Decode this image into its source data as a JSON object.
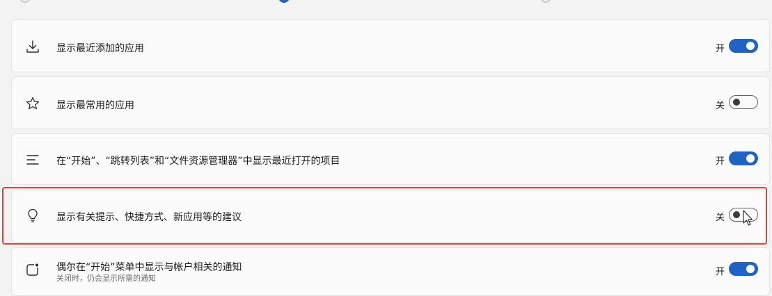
{
  "rows": [
    {
      "icon": "download-icon",
      "label": "显示最近添加的应用",
      "state": "开",
      "on": true
    },
    {
      "icon": "star-icon",
      "label": "显示最常用的应用",
      "state": "关",
      "on": false
    },
    {
      "icon": "list-icon",
      "label": "在“开始”、“跳转列表”和“文件资源管理器”中显示最近打开的项目",
      "state": "开",
      "on": true
    },
    {
      "icon": "lightbulb-icon",
      "label": "显示有关提示、快捷方式、新应用等的建议",
      "state": "关",
      "on": false
    },
    {
      "icon": "notification-icon",
      "label": "偶尔在“开始”菜单中显示与帐户相关的通知",
      "sublabel": "关闭时，仍会显示所需的通知",
      "state": "开",
      "on": true
    }
  ],
  "colors": {
    "accent": "#1f63c4",
    "highlight": "#d9483b"
  }
}
